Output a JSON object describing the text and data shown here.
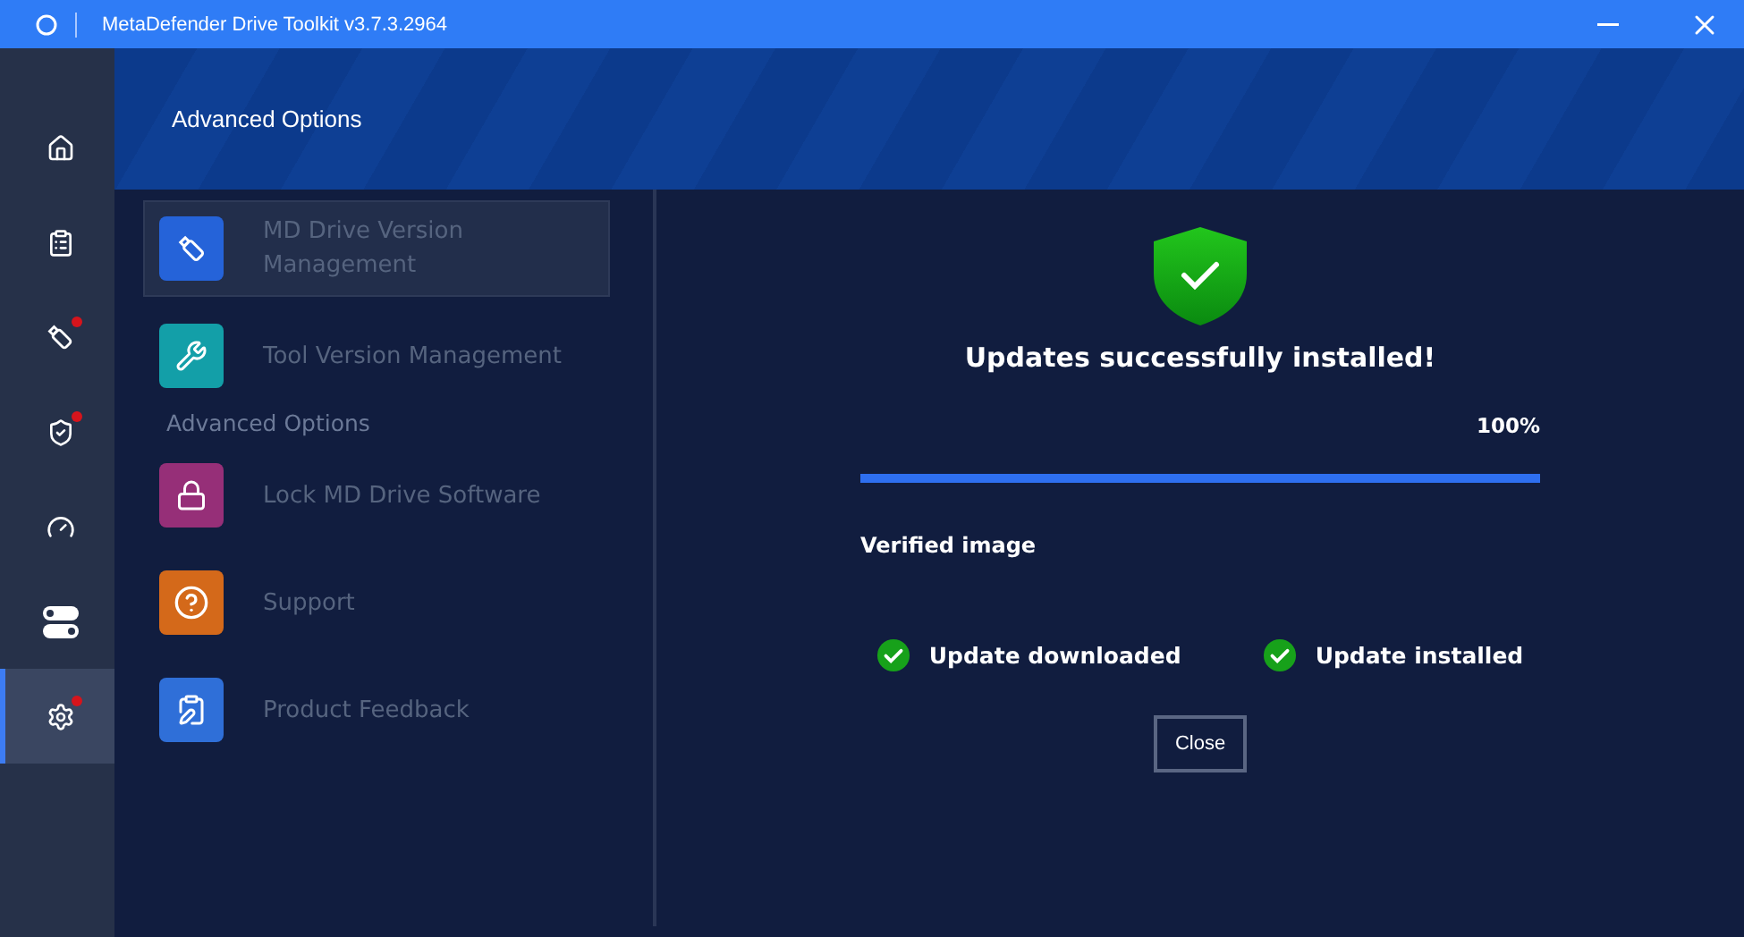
{
  "window": {
    "title": "MetaDefender Drive Toolkit v3.7.3.2964"
  },
  "rail": [
    {
      "selected": false,
      "badge": false
    },
    {
      "selected": false,
      "badge": false
    },
    {
      "selected": false,
      "badge": true
    },
    {
      "selected": false,
      "badge": true
    },
    {
      "selected": false,
      "badge": false
    },
    {
      "selected": false,
      "badge": false
    },
    {
      "selected": true,
      "badge": true
    }
  ],
  "header": {
    "title": "Advanced Options"
  },
  "menu": [
    {
      "kind": "item",
      "label": "MD Drive Version Management",
      "color": "#2563d9",
      "selected": true
    },
    {
      "kind": "item",
      "label": "Tool Version Management",
      "color": "#139fa8",
      "selected": false
    },
    {
      "kind": "heading",
      "label": "Advanced Options"
    },
    {
      "kind": "item",
      "label": "Lock MD Drive Software",
      "color": "#962f78",
      "selected": false
    },
    {
      "kind": "item",
      "label": "Support",
      "color": "#d4691a",
      "selected": false
    },
    {
      "kind": "item",
      "label": "Product Feedback",
      "color": "#2f6fd8",
      "selected": false
    }
  ],
  "result": {
    "title": "Updates successfully installed!",
    "percent": "100%",
    "level": 1,
    "image_label": "Verified image",
    "steps": [
      {
        "label": "Update downloaded",
        "done": true
      },
      {
        "label": "Update installed",
        "done": true
      }
    ],
    "button": "Close"
  }
}
